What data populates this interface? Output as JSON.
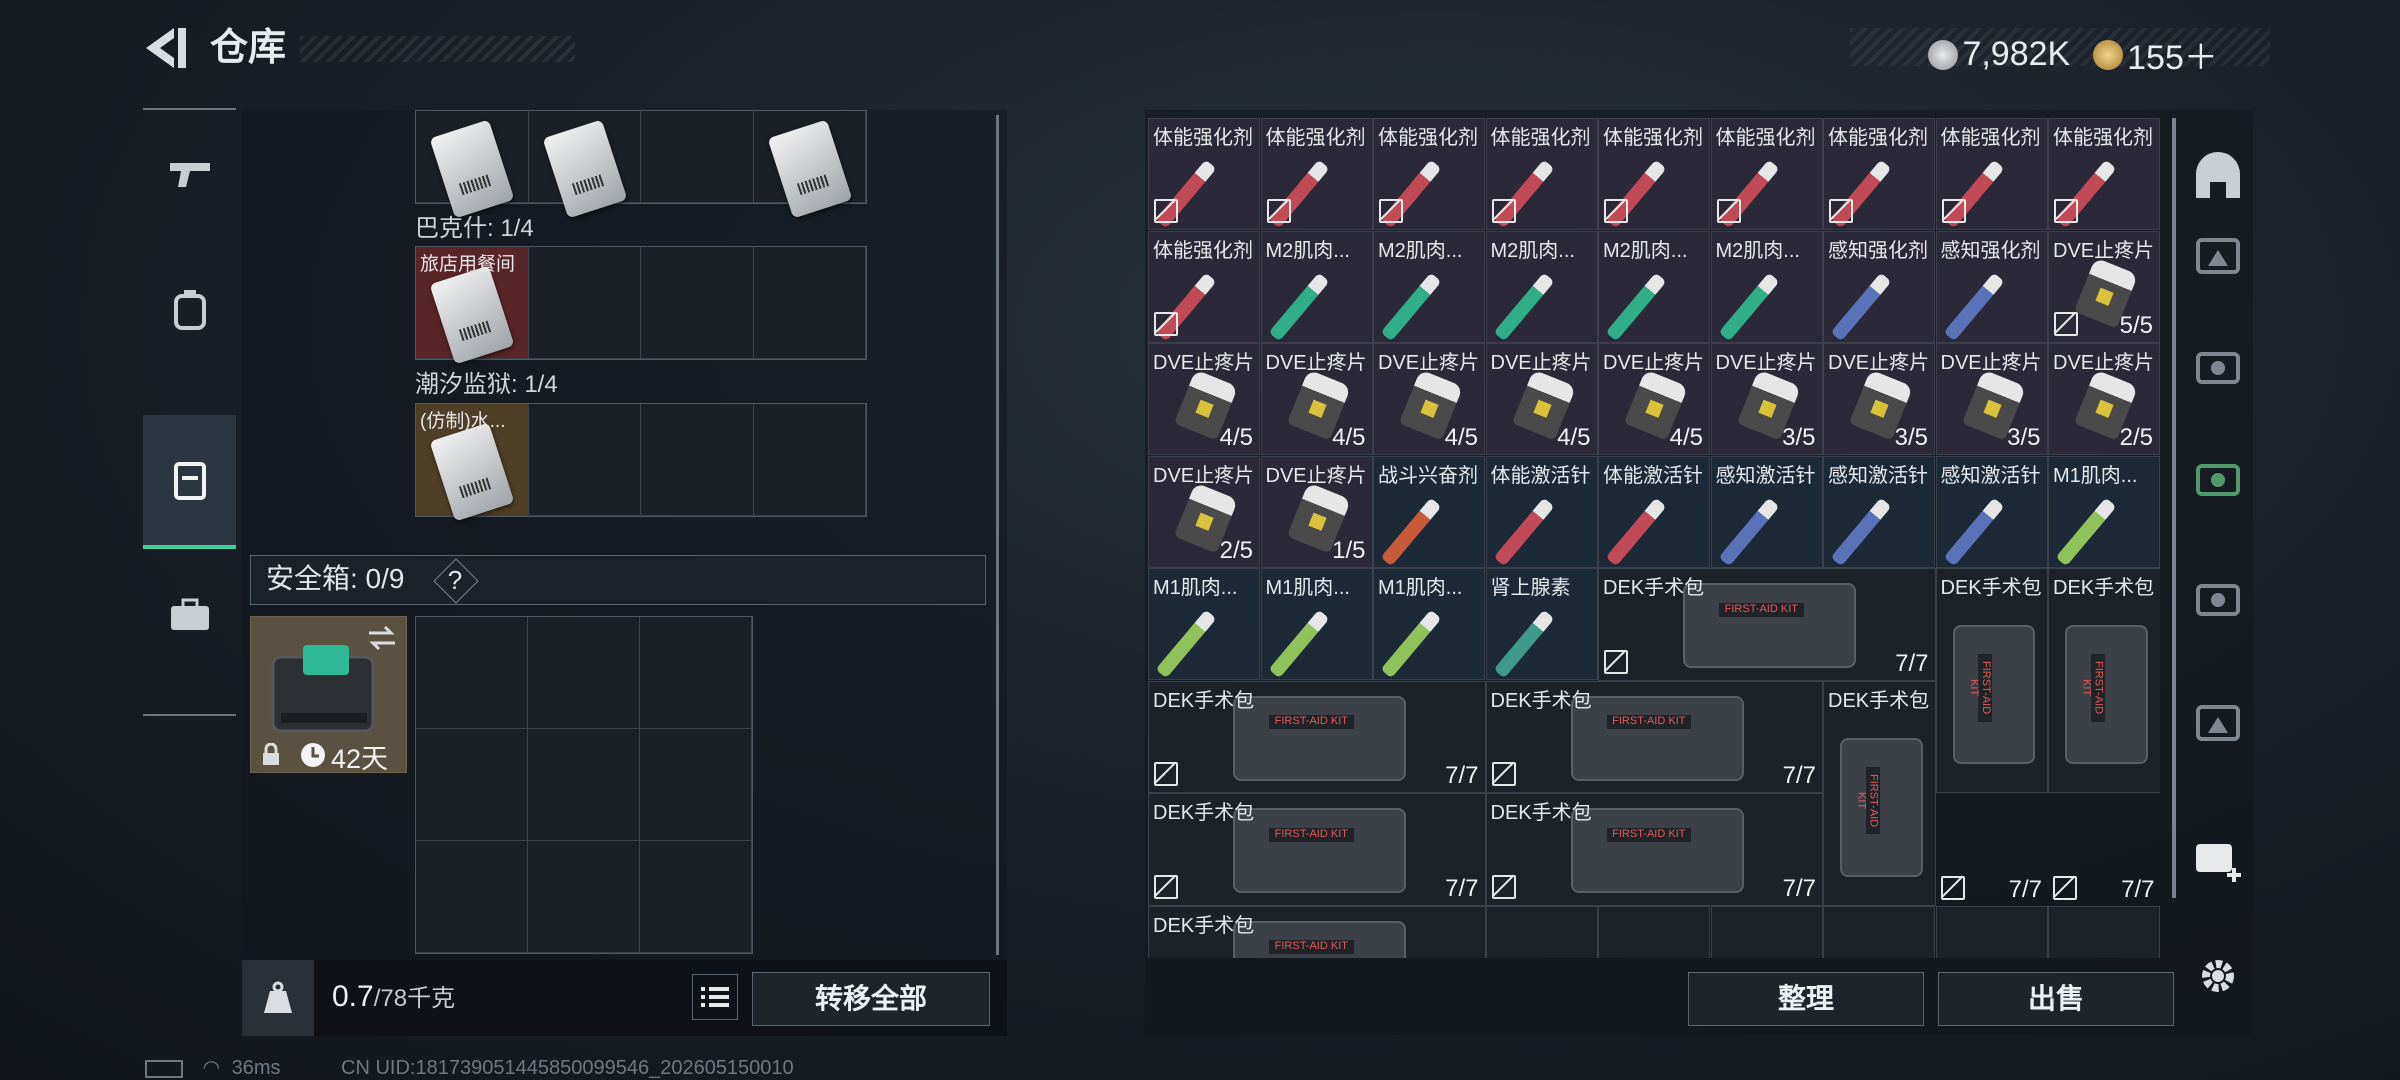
{
  "header": {
    "title": "仓库"
  },
  "currency": {
    "coins_value": "7,982K",
    "tokens_value": "155＋"
  },
  "left_panel": {
    "groups": [
      {
        "label": "巴克什: 1/4",
        "item_name": "旅店用餐间"
      },
      {
        "label": "潮汐监狱: 1/4",
        "item_name": "(仿制)水..."
      }
    ],
    "safe_box": {
      "label": "安全箱: 0/9",
      "help": "?",
      "timer": "42天"
    },
    "weight": {
      "current": "0.7",
      "max": "/78千克"
    },
    "transfer_all_label": "转移全部"
  },
  "inventory": {
    "small_items": [
      {
        "name": "体能强化剂",
        "color": "purple",
        "icon": "syringe-red-icon",
        "flag": true
      },
      {
        "name": "体能强化剂",
        "color": "purple",
        "icon": "syringe-red-icon",
        "flag": true
      },
      {
        "name": "体能强化剂",
        "color": "purple",
        "icon": "syringe-red-icon",
        "flag": true
      },
      {
        "name": "体能强化剂",
        "color": "purple",
        "icon": "syringe-red-icon",
        "flag": true
      },
      {
        "name": "体能强化剂",
        "color": "purple",
        "icon": "syringe-red-icon",
        "flag": true
      },
      {
        "name": "体能强化剂",
        "color": "purple",
        "icon": "syringe-red-icon",
        "flag": true
      },
      {
        "name": "体能强化剂",
        "color": "purple",
        "icon": "syringe-red-icon",
        "flag": true
      },
      {
        "name": "体能强化剂",
        "color": "purple",
        "icon": "syringe-red-icon",
        "flag": true
      },
      {
        "name": "体能强化剂",
        "color": "purple",
        "icon": "syringe-red-icon",
        "flag": true
      },
      {
        "name": "体能强化剂",
        "color": "purple",
        "icon": "syringe-red-icon",
        "flag": true
      },
      {
        "name": "M2肌肉...",
        "color": "purple",
        "icon": "syringe-green-icon"
      },
      {
        "name": "M2肌肉...",
        "color": "purple",
        "icon": "syringe-green-icon"
      },
      {
        "name": "M2肌肉...",
        "color": "purple",
        "icon": "syringe-green-icon"
      },
      {
        "name": "M2肌肉...",
        "color": "purple",
        "icon": "syringe-green-icon"
      },
      {
        "name": "M2肌肉...",
        "color": "purple",
        "icon": "syringe-green-icon"
      },
      {
        "name": "感知强化剂",
        "color": "purple",
        "icon": "syringe-blue-icon"
      },
      {
        "name": "感知强化剂",
        "color": "purple",
        "icon": "syringe-blue-icon"
      },
      {
        "name": "DVE止疼片",
        "color": "purple",
        "icon": "pill-bottle-icon",
        "count": "5/5",
        "flag": true
      },
      {
        "name": "DVE止疼片",
        "color": "purple",
        "icon": "pill-bottle-icon",
        "count": "4/5"
      },
      {
        "name": "DVE止疼片",
        "color": "purple",
        "icon": "pill-bottle-icon",
        "count": "4/5"
      },
      {
        "name": "DVE止疼片",
        "color": "purple",
        "icon": "pill-bottle-icon",
        "count": "4/5"
      },
      {
        "name": "DVE止疼片",
        "color": "purple",
        "icon": "pill-bottle-icon",
        "count": "4/5"
      },
      {
        "name": "DVE止疼片",
        "color": "purple",
        "icon": "pill-bottle-icon",
        "count": "4/5"
      },
      {
        "name": "DVE止疼片",
        "color": "purple",
        "icon": "pill-bottle-icon",
        "count": "3/5"
      },
      {
        "name": "DVE止疼片",
        "color": "purple",
        "icon": "pill-bottle-icon",
        "count": "3/5"
      },
      {
        "name": "DVE止疼片",
        "color": "purple",
        "icon": "pill-bottle-icon",
        "count": "3/5"
      },
      {
        "name": "DVE止疼片",
        "color": "purple",
        "icon": "pill-bottle-icon",
        "count": "2/5"
      },
      {
        "name": "DVE止疼片",
        "color": "purple",
        "icon": "pill-bottle-icon",
        "count": "2/5"
      },
      {
        "name": "DVE止疼片",
        "color": "purple",
        "icon": "pill-bottle-icon",
        "count": "1/5"
      },
      {
        "name": "战斗兴奋剂",
        "color": "blue",
        "icon": "syringe-orange-icon"
      },
      {
        "name": "体能激活针",
        "color": "blue",
        "icon": "syringe-red-icon"
      },
      {
        "name": "体能激活针",
        "color": "blue",
        "icon": "syringe-red-icon"
      },
      {
        "name": "感知激活针",
        "color": "blue",
        "icon": "syringe-blue-icon"
      },
      {
        "name": "感知激活针",
        "color": "blue",
        "icon": "syringe-blue-icon"
      },
      {
        "name": "感知激活针",
        "color": "blue",
        "icon": "syringe-blue-icon"
      },
      {
        "name": "M1肌肉...",
        "color": "blue",
        "icon": "syringe-lime-icon"
      },
      {
        "name": "M1肌肉...",
        "color": "blue",
        "icon": "syringe-lime-icon"
      },
      {
        "name": "M1肌肉...",
        "color": "blue",
        "icon": "syringe-lime-icon"
      },
      {
        "name": "M1肌肉...",
        "color": "blue",
        "icon": "syringe-lime-icon"
      },
      {
        "name": "肾上腺素",
        "color": "blue",
        "icon": "syringe-teal-icon"
      }
    ],
    "kits": [
      {
        "name": "DEK手术包",
        "count": "7/7",
        "orientation": "h"
      },
      {
        "name": "DEK手术包",
        "count": "",
        "orientation": "v"
      },
      {
        "name": "DEK手术包",
        "count": "",
        "orientation": "v"
      },
      {
        "name": "DEK手术包",
        "count": "7/7",
        "orientation": "h"
      },
      {
        "name": "DEK手术包",
        "count": "7/7",
        "orientation": "h"
      },
      {
        "name": "DEK手术包",
        "count": "",
        "orientation": "v"
      },
      {
        "name": "DEK手术包",
        "count": "7/7",
        "orientation": "h"
      },
      {
        "name": "DEK手术包",
        "count": "7/7",
        "orientation": "h"
      },
      {
        "name": "DEK手术包",
        "count": "",
        "orientation": "h"
      }
    ],
    "vertical_kit_counts": [
      "7/7",
      "7/7"
    ],
    "kit_strip_text": "FIRST-AID KIT"
  },
  "buttons": {
    "sort_label": "整理",
    "sell_label": "出售"
  },
  "status_bar": {
    "ping": "36ms",
    "uid": "CN UID:1817390514458500995­46_202605150010"
  },
  "colors": {
    "accent": "#3fcf9a",
    "purple_slot": "#2b2837",
    "blue_slot": "#1c2a37"
  }
}
